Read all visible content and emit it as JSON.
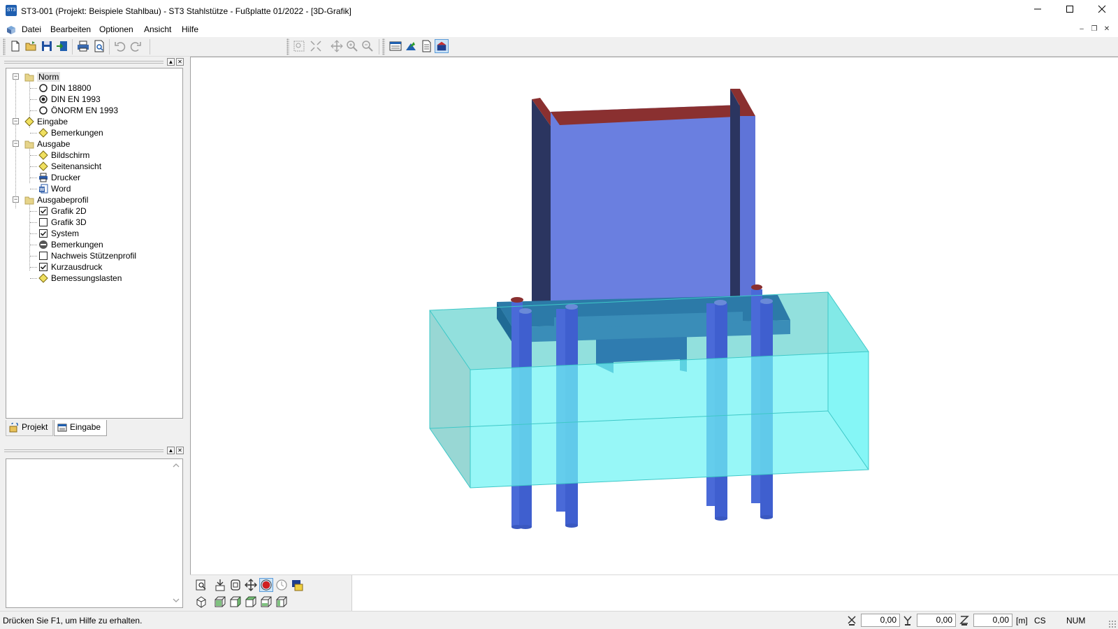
{
  "window": {
    "title": "ST3-001 (Projekt: Beispiele Stahlbau) - ST3 Stahlstütze - Fußplatte 01/2022 - [3D-Grafik]",
    "app_icon_text": "ST3"
  },
  "menu": {
    "items": [
      "Datei",
      "Bearbeiten",
      "Optionen",
      "Ansicht",
      "Hilfe"
    ]
  },
  "toolbar": {
    "icons": [
      "new-document-icon",
      "open-folder-icon",
      "save-icon",
      "export-icon",
      "print-icon",
      "print-preview-icon",
      "undo-icon",
      "redo-icon",
      "zoom-window-icon",
      "zoom-all-icon",
      "pan-icon",
      "zoom-in-icon",
      "zoom-out-icon",
      "input-form-icon",
      "view-3d-icon",
      "report-icon",
      "graphic-3d-active-icon"
    ]
  },
  "tree": {
    "norm": {
      "label": "Norm",
      "children": [
        "DIN 18800",
        "DIN EN 1993",
        "ÖNORM EN 1993"
      ],
      "selected": "DIN EN 1993"
    },
    "eingabe": {
      "label": "Eingabe",
      "children": [
        "Bemerkungen"
      ]
    },
    "ausgabe": {
      "label": "Ausgabe",
      "children": [
        "Bildschirm",
        "Seitenansicht",
        "Drucker",
        "Word"
      ]
    },
    "ausgabeprofil": {
      "label": "Ausgabeprofil",
      "children": [
        {
          "label": "Grafik 2D",
          "state": "checked"
        },
        {
          "label": "Grafik 3D",
          "state": "unchecked"
        },
        {
          "label": "System",
          "state": "checked"
        },
        {
          "label": "Bemerkungen",
          "state": "disabled"
        },
        {
          "label": "Nachweis Stützenprofil",
          "state": "unchecked"
        },
        {
          "label": "Kurzausdruck",
          "state": "checked"
        },
        {
          "label": "Bemessungslasten",
          "state": "diamond"
        }
      ]
    }
  },
  "tabs": [
    {
      "label": "Projekt",
      "active": false
    },
    {
      "label": "Eingabe",
      "active": true
    }
  ],
  "viewport": {
    "scene": "3D column base plate with anchor bolts in concrete block",
    "colors": {
      "column": "#6a7fe0",
      "column_dark": "#2b3560",
      "section_cut": "#8a3030",
      "concrete": "#6ff4f4",
      "plate": "#3a8db8",
      "bolt": "#4a6ad8"
    }
  },
  "viewbar": {
    "icons_row1": [
      "view-zoom-icon",
      "view-front-icon",
      "view-fit-icon",
      "view-move-icon",
      "view-rotate-active-icon",
      "view-reset-icon",
      "view-print-icon"
    ],
    "icons_row2": [
      "iso-view-icon",
      "cube-front-icon",
      "cube-right-icon",
      "cube-back-icon",
      "cube-left-icon",
      "cube-top-icon"
    ]
  },
  "statusbar": {
    "help_text": "Drücken Sie F1, um Hilfe zu erhalten.",
    "coord_x": "0,00",
    "coord_y": "0,00",
    "coord_z": "0,00",
    "unit": "[m]",
    "cs": "CS",
    "num": "NUM"
  }
}
